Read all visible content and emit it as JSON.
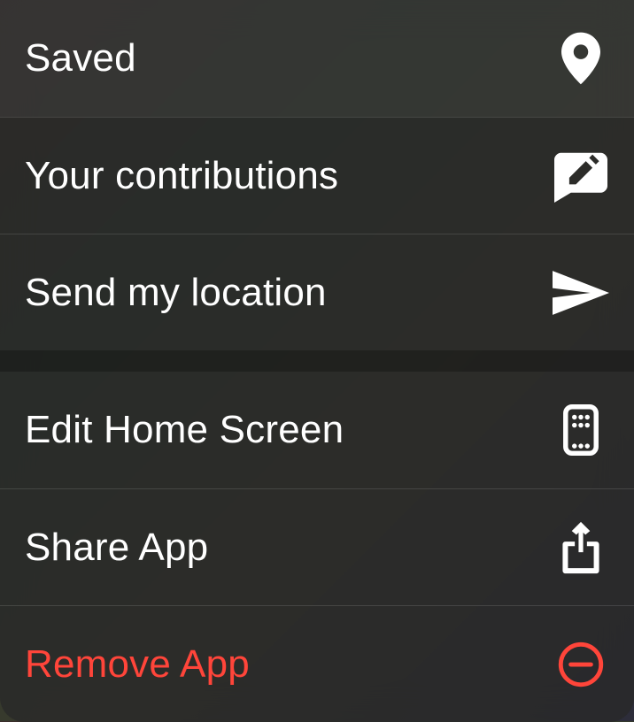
{
  "menu": {
    "group1": {
      "items": [
        {
          "label": "Saved",
          "icon": "pin-icon",
          "destructive": false
        },
        {
          "label": "Your contributions",
          "icon": "edit-bubble-icon",
          "destructive": false
        },
        {
          "label": "Send my location",
          "icon": "send-icon",
          "destructive": false
        }
      ]
    },
    "group2": {
      "items": [
        {
          "label": "Edit Home Screen",
          "icon": "phone-grid-icon",
          "destructive": false
        },
        {
          "label": "Share App",
          "icon": "share-icon",
          "destructive": false
        },
        {
          "label": "Remove App",
          "icon": "minus-circle-icon",
          "destructive": true
        }
      ]
    }
  }
}
